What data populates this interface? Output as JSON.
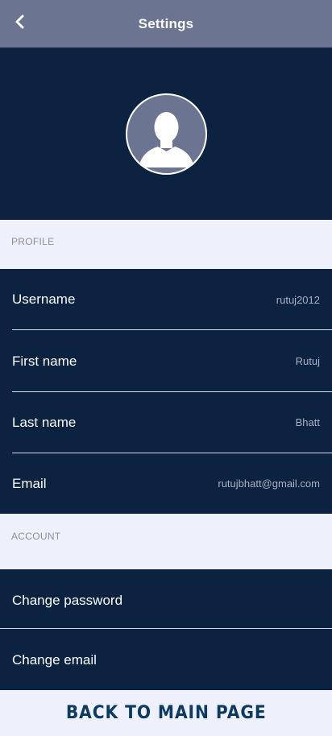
{
  "header": {
    "title": "Settings",
    "back_icon": "chevron-left-icon"
  },
  "avatar": {
    "icon": "user-silhouette-icon"
  },
  "profile": {
    "section_label": "PROFILE",
    "username": {
      "label": "Username",
      "value": "rutuj2012"
    },
    "first_name": {
      "label": "First name",
      "value": "Rutuj"
    },
    "last_name": {
      "label": "Last name",
      "value": "Bhatt"
    },
    "email": {
      "label": "Email",
      "value": "rutujbhatt@gmail.com"
    }
  },
  "account": {
    "section_label": "ACCOUNT",
    "change_password": {
      "label": "Change password"
    },
    "change_email": {
      "label": "Change email"
    }
  },
  "footer": {
    "label": "BACK TO MAIN PAGE"
  },
  "colors": {
    "header_bg": "#6b7591",
    "body_bg": "#0b2241",
    "section_bg": "#eef1fb",
    "footer_text": "#0b3a63"
  }
}
